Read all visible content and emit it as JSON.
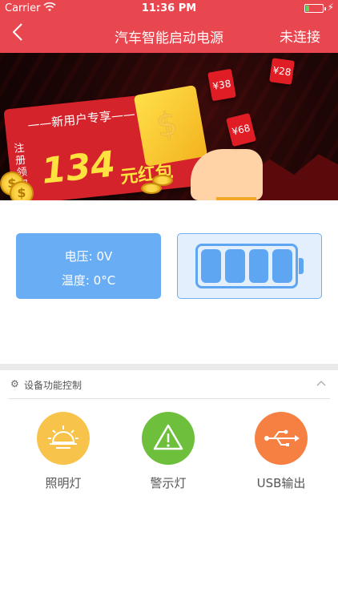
{
  "status_bar": {
    "carrier": "Carrier",
    "time": "11:36 PM",
    "wifi_icon": "wifi-icon",
    "battery_icon": "battery-icon",
    "charging_icon": "charging-bolt-icon"
  },
  "nav": {
    "back_icon": "chevron-left-icon",
    "title": "汽车智能启动电源",
    "right_action": "未连接"
  },
  "banner": {
    "promo_headline": "新用户专享",
    "promo_side": "注册领取",
    "promo_amount": "134",
    "promo_unit": "元红包",
    "red_packets": [
      "¥38",
      "¥28",
      "¥68"
    ],
    "coin_symbol": "$",
    "page_count": 5,
    "active_page": 1
  },
  "status_panel": {
    "voltage": "电压: 0V",
    "temperature": "温度: 0°C",
    "battery_cells": 4
  },
  "device_controls": {
    "section_icon": "gear-icon",
    "section_title": "设备功能控制",
    "collapse_icon": "chevron-up-icon",
    "items": [
      {
        "label": "照明灯",
        "icon": "sunrise-light-icon",
        "color": "#f7c34a"
      },
      {
        "label": "警示灯",
        "icon": "warning-triangle-icon",
        "color": "#6dbf3c"
      },
      {
        "label": "USB输出",
        "icon": "usb-icon",
        "color": "#f67f42"
      }
    ]
  },
  "colors": {
    "brand_red": "#e8474f",
    "panel_blue": "#69aef5",
    "battery_blue": "#5ea6f2"
  }
}
